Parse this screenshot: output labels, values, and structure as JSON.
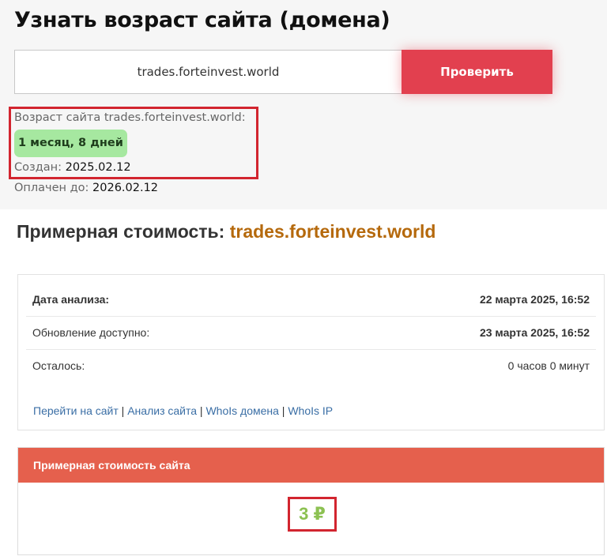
{
  "header": {
    "title": "Узнать возраст сайта (домена)"
  },
  "search": {
    "domain_value": "trades.forteinvest.world",
    "check_button": "Проверить"
  },
  "age_result": {
    "label": "Возраст сайта trades.forteinvest.world:",
    "age_num1": "1",
    "age_word1": " месяц, ",
    "age_num2": "8",
    "age_word2": " дней",
    "created_label": "Создан: ",
    "created_value": "2025.02.12",
    "paid_label": "Оплачен до: ",
    "paid_value": "2026.02.12",
    "badge_color": "#a6e8a0"
  },
  "estimate": {
    "title_prefix": "Примерная стоимость: ",
    "title_domain": "trades.forteinvest.world",
    "domain_color": "#b5690c"
  },
  "info": {
    "analysis_date_label": "Дата анализа:",
    "analysis_date_value": "22 марта 2025, 16:52",
    "update_label": "Обновление доступно:",
    "update_value": "23 марта 2025, 16:52",
    "remaining_label": "Осталось:",
    "remaining_hours_num": "0",
    "remaining_hours_word": " часов ",
    "remaining_minutes_num": "0",
    "remaining_minutes_word": " минут"
  },
  "links": {
    "goto_site": "Перейти на сайт",
    "site_analysis": "Анализ сайта",
    "whois_domain": "WhoIs домена",
    "whois_ip": "WhoIs IP",
    "separator": " | "
  },
  "price": {
    "header": "Примерная стоимость сайта",
    "value": "3 ₽",
    "header_color": "#e5604d",
    "value_color": "#8cc152"
  },
  "colors": {
    "accent_button": "#e2404f",
    "highlight_border": "#d2252f"
  }
}
